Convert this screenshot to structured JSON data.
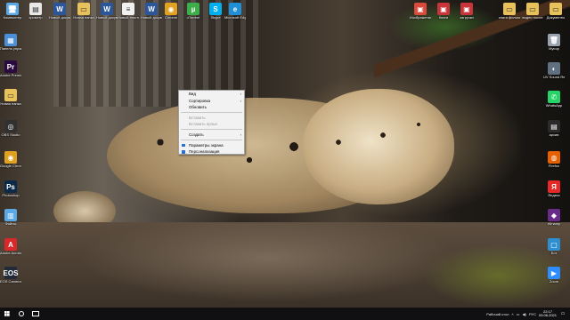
{
  "desktop": {
    "top_icons": [
      {
        "label": "Компьютер",
        "icon": "computer-icon",
        "color": "#5aa9e6",
        "glyph": "🖥"
      },
      {
        "label": "хрометр",
        "icon": "document-icon",
        "color": "#e8e8e8",
        "glyph": "▤"
      },
      {
        "label": "Новый документ",
        "icon": "word-icon",
        "color": "#2b579a",
        "glyph": "W"
      },
      {
        "label": "Новая папка",
        "icon": "folder-icon",
        "color": "#e8c15a",
        "glyph": "▭"
      },
      {
        "label": "Новый документ",
        "icon": "word-icon",
        "color": "#2b579a",
        "glyph": "W"
      },
      {
        "label": "Новый текстовый",
        "icon": "text-icon",
        "color": "#f0f0f0",
        "glyph": "≡"
      },
      {
        "label": "Новый документ (2)",
        "icon": "word-icon",
        "color": "#2b579a",
        "glyph": "W"
      },
      {
        "label": "Chrome",
        "icon": "chrome-icon",
        "color": "#e0a020",
        "glyph": "◉"
      },
      {
        "label": "uTorrent",
        "icon": "utorrent-icon",
        "color": "#3dae49",
        "glyph": "µ"
      },
      {
        "label": "Skype",
        "icon": "skype-icon",
        "color": "#00aff0",
        "glyph": "S"
      },
      {
        "label": "Microsoft Edge",
        "icon": "edge-icon",
        "color": "#1f8fd6",
        "glyph": "e"
      }
    ],
    "top_right_icons": [
      {
        "label": "Изображения",
        "icon": "image-folder-icon",
        "color": "#d94a3a",
        "glyph": "▣"
      },
      {
        "label": "Книги",
        "icon": "books-icon",
        "color": "#c8343a",
        "glyph": "▣"
      },
      {
        "label": "загрузки",
        "icon": "downloads-icon",
        "color": "#c8343a",
        "glyph": "▣"
      },
      {
        "label": "книга фильмы",
        "icon": "folder-icon",
        "color": "#e8c15a",
        "glyph": "▭"
      },
      {
        "label": "видео после",
        "icon": "video-folder-icon",
        "color": "#e8c15a",
        "glyph": "▭"
      },
      {
        "label": "Документы",
        "icon": "folder-icon",
        "color": "#e8c15a",
        "glyph": "▭"
      }
    ],
    "left_icons": [
      {
        "label": "Панель управления",
        "icon": "control-panel-icon",
        "color": "#4a8fd8",
        "glyph": "▦"
      },
      {
        "label": "Adobe Premiere",
        "icon": "premiere-icon",
        "color": "#2a0a40",
        "glyph": "Pr"
      },
      {
        "label": "Новая папка",
        "icon": "folder-icon",
        "color": "#e8c15a",
        "glyph": "▭"
      },
      {
        "label": "OBS Studio",
        "icon": "obs-icon",
        "color": "#303030",
        "glyph": "◎"
      },
      {
        "label": "Google Chrome",
        "icon": "chrome-icon",
        "color": "#e0a020",
        "glyph": "◉"
      },
      {
        "label": "Photoshop",
        "icon": "photoshop-icon",
        "color": "#0b2a4a",
        "glyph": "Ps"
      },
      {
        "label": "Файлы",
        "icon": "files-icon",
        "color": "#5aa9e6",
        "glyph": "▥"
      },
      {
        "label": "Adobe Acrobat",
        "icon": "acrobat-icon",
        "color": "#d8282a",
        "glyph": "A"
      },
      {
        "label": "EOS Camera Movie EX",
        "icon": "camera-icon",
        "color": "#222a3a",
        "glyph": "EOS"
      }
    ],
    "right_icons": [
      {
        "label": "Мусор",
        "icon": "recycle-bin-icon",
        "color": "#9aa3ad",
        "glyph": "🗑"
      },
      {
        "label": "UV Sound Recorder",
        "icon": "recorder-icon",
        "color": "#607080",
        "glyph": "◐"
      },
      {
        "label": "WhatsApp",
        "icon": "whatsapp-icon",
        "color": "#25d366",
        "glyph": "✆"
      },
      {
        "label": "архив",
        "icon": "archive-icon",
        "color": "#2a2a2a",
        "glyph": "▤"
      },
      {
        "label": "Firefox",
        "icon": "firefox-icon",
        "color": "#e66000",
        "glyph": "◍"
      },
      {
        "label": "Яндекс",
        "icon": "yandex-icon",
        "color": "#e62828",
        "glyph": "Я"
      },
      {
        "label": "Winamp",
        "icon": "winamp-icon",
        "color": "#6a2a8a",
        "glyph": "◆"
      },
      {
        "label": "Бот",
        "icon": "bot-icon",
        "color": "#2d8fd0",
        "glyph": "▢"
      },
      {
        "label": "Zoom",
        "icon": "zoom-icon",
        "color": "#2d8cff",
        "glyph": "▶"
      }
    ]
  },
  "context_menu": {
    "items": [
      {
        "label": "Вид",
        "submenu": true,
        "disabled": false
      },
      {
        "label": "Сортировка",
        "submenu": true,
        "disabled": false
      },
      {
        "label": "Обновить",
        "submenu": false,
        "disabled": false
      },
      {
        "sep": true
      },
      {
        "label": "Вставить",
        "submenu": false,
        "disabled": true
      },
      {
        "label": "Вставить ярлык",
        "submenu": false,
        "disabled": true
      },
      {
        "sep": true
      },
      {
        "label": "Создать",
        "submenu": true,
        "disabled": false
      },
      {
        "sep": true
      },
      {
        "label": "Параметры экрана",
        "submenu": false,
        "disabled": false,
        "icon": "display-settings-icon"
      },
      {
        "label": "Персонализация",
        "submenu": false,
        "disabled": false,
        "icon": "personalize-icon"
      }
    ]
  },
  "taskbar": {
    "start_icon": "windows-start-icon",
    "search_icon": "search-icon",
    "task_view_icon": "task-view-icon",
    "tray_label": "Рабочий стол",
    "language": "РУС",
    "time": "22:17",
    "date": "09.06.2021"
  }
}
